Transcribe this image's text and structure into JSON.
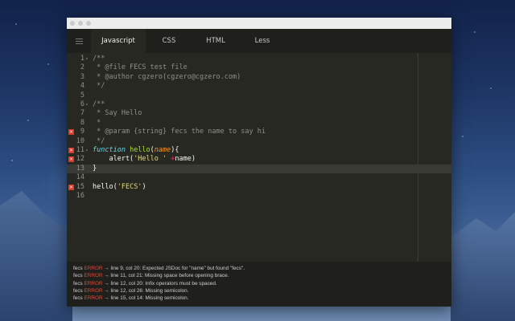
{
  "tabs": [
    {
      "label": "Javascript",
      "active": true
    },
    {
      "label": "CSS",
      "active": false
    },
    {
      "label": "HTML",
      "active": false
    },
    {
      "label": "Less",
      "active": false
    }
  ],
  "code_lines": [
    {
      "n": "1",
      "fold": "▾",
      "err": false,
      "tokens": [
        {
          "c": "c",
          "t": "/**"
        }
      ]
    },
    {
      "n": "2",
      "fold": "",
      "err": false,
      "tokens": [
        {
          "c": "c",
          "t": " * @file FECS test file"
        }
      ]
    },
    {
      "n": "3",
      "fold": "",
      "err": false,
      "tokens": [
        {
          "c": "c",
          "t": " * @author cgzero(cgzero@cgzero.com)"
        }
      ]
    },
    {
      "n": "4",
      "fold": "",
      "err": false,
      "tokens": [
        {
          "c": "c",
          "t": " */"
        }
      ]
    },
    {
      "n": "5",
      "fold": "",
      "err": false,
      "tokens": []
    },
    {
      "n": "6",
      "fold": "▾",
      "err": false,
      "tokens": [
        {
          "c": "c",
          "t": "/**"
        }
      ]
    },
    {
      "n": "7",
      "fold": "",
      "err": false,
      "tokens": [
        {
          "c": "c",
          "t": " * Say Hello"
        }
      ]
    },
    {
      "n": "8",
      "fold": "",
      "err": false,
      "tokens": [
        {
          "c": "c",
          "t": " *"
        }
      ]
    },
    {
      "n": "9",
      "fold": "",
      "err": true,
      "tokens": [
        {
          "c": "c",
          "t": " * @param {string} fecs the name to say hi"
        }
      ]
    },
    {
      "n": "10",
      "fold": "",
      "err": false,
      "tokens": [
        {
          "c": "c",
          "t": " */"
        }
      ]
    },
    {
      "n": "11",
      "fold": "▾",
      "err": true,
      "tokens": [
        {
          "c": "k",
          "t": "function"
        },
        {
          "c": "",
          "t": " "
        },
        {
          "c": "f",
          "t": "hello"
        },
        {
          "c": "",
          "t": "("
        },
        {
          "c": "p",
          "t": "name"
        },
        {
          "c": "",
          "t": "){"
        }
      ]
    },
    {
      "n": "12",
      "fold": "",
      "err": true,
      "tokens": [
        {
          "c": "",
          "t": "    alert("
        },
        {
          "c": "s",
          "t": "'Hello '"
        },
        {
          "c": "",
          "t": " "
        },
        {
          "c": "o",
          "t": "+"
        },
        {
          "c": "",
          "t": "name)"
        }
      ]
    },
    {
      "n": "13",
      "fold": "",
      "err": false,
      "current": true,
      "tokens": [
        {
          "c": "",
          "t": "}"
        }
      ]
    },
    {
      "n": "14",
      "fold": "",
      "err": false,
      "tokens": []
    },
    {
      "n": "15",
      "fold": "",
      "err": true,
      "tokens": [
        {
          "c": "",
          "t": "hello("
        },
        {
          "c": "s",
          "t": "'FECS'"
        },
        {
          "c": "",
          "t": ")"
        }
      ]
    },
    {
      "n": "16",
      "fold": "",
      "err": false,
      "tokens": []
    }
  ],
  "console_lines": [
    {
      "prefix": "fecs",
      "level": "ERROR",
      "message": "→ line 9, col 20: Expected JSDoc for \"name\" but found \"fecs\"."
    },
    {
      "prefix": "fecs",
      "level": "ERROR",
      "message": "→ line 11, col 21: Missing space before opening brace."
    },
    {
      "prefix": "fecs",
      "level": "ERROR",
      "message": "→ line 12, col 20: Infix operators must be spaced."
    },
    {
      "prefix": "fecs",
      "level": "ERROR",
      "message": "→ line 12, col 26: Missing semicolon."
    },
    {
      "prefix": "fecs",
      "level": "ERROR",
      "message": "→ line 15, col 14: Missing semicolon."
    }
  ],
  "icons": {
    "error": "error-x-icon",
    "menu": "hamburger-menu-icon",
    "fold": "fold-arrow-icon"
  }
}
